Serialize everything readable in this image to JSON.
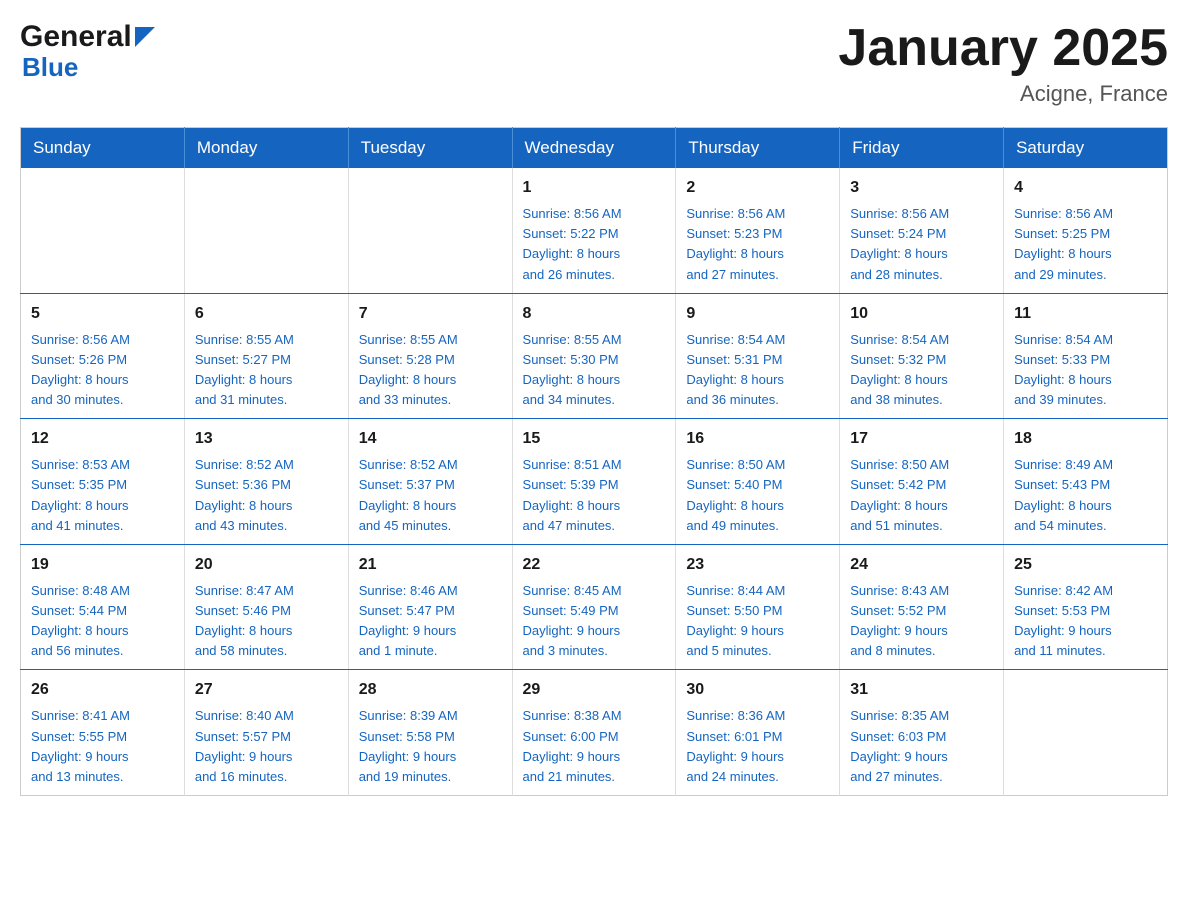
{
  "header": {
    "logo_general": "General",
    "logo_blue": "Blue",
    "title": "January 2025",
    "location": "Acigne, France"
  },
  "days_of_week": [
    "Sunday",
    "Monday",
    "Tuesday",
    "Wednesday",
    "Thursday",
    "Friday",
    "Saturday"
  ],
  "weeks": [
    [
      {
        "day": "",
        "info": []
      },
      {
        "day": "",
        "info": []
      },
      {
        "day": "",
        "info": []
      },
      {
        "day": "1",
        "info": [
          "Sunrise: 8:56 AM",
          "Sunset: 5:22 PM",
          "Daylight: 8 hours",
          "and 26 minutes."
        ]
      },
      {
        "day": "2",
        "info": [
          "Sunrise: 8:56 AM",
          "Sunset: 5:23 PM",
          "Daylight: 8 hours",
          "and 27 minutes."
        ]
      },
      {
        "day": "3",
        "info": [
          "Sunrise: 8:56 AM",
          "Sunset: 5:24 PM",
          "Daylight: 8 hours",
          "and 28 minutes."
        ]
      },
      {
        "day": "4",
        "info": [
          "Sunrise: 8:56 AM",
          "Sunset: 5:25 PM",
          "Daylight: 8 hours",
          "and 29 minutes."
        ]
      }
    ],
    [
      {
        "day": "5",
        "info": [
          "Sunrise: 8:56 AM",
          "Sunset: 5:26 PM",
          "Daylight: 8 hours",
          "and 30 minutes."
        ]
      },
      {
        "day": "6",
        "info": [
          "Sunrise: 8:55 AM",
          "Sunset: 5:27 PM",
          "Daylight: 8 hours",
          "and 31 minutes."
        ]
      },
      {
        "day": "7",
        "info": [
          "Sunrise: 8:55 AM",
          "Sunset: 5:28 PM",
          "Daylight: 8 hours",
          "and 33 minutes."
        ]
      },
      {
        "day": "8",
        "info": [
          "Sunrise: 8:55 AM",
          "Sunset: 5:30 PM",
          "Daylight: 8 hours",
          "and 34 minutes."
        ]
      },
      {
        "day": "9",
        "info": [
          "Sunrise: 8:54 AM",
          "Sunset: 5:31 PM",
          "Daylight: 8 hours",
          "and 36 minutes."
        ]
      },
      {
        "day": "10",
        "info": [
          "Sunrise: 8:54 AM",
          "Sunset: 5:32 PM",
          "Daylight: 8 hours",
          "and 38 minutes."
        ]
      },
      {
        "day": "11",
        "info": [
          "Sunrise: 8:54 AM",
          "Sunset: 5:33 PM",
          "Daylight: 8 hours",
          "and 39 minutes."
        ]
      }
    ],
    [
      {
        "day": "12",
        "info": [
          "Sunrise: 8:53 AM",
          "Sunset: 5:35 PM",
          "Daylight: 8 hours",
          "and 41 minutes."
        ]
      },
      {
        "day": "13",
        "info": [
          "Sunrise: 8:52 AM",
          "Sunset: 5:36 PM",
          "Daylight: 8 hours",
          "and 43 minutes."
        ]
      },
      {
        "day": "14",
        "info": [
          "Sunrise: 8:52 AM",
          "Sunset: 5:37 PM",
          "Daylight: 8 hours",
          "and 45 minutes."
        ]
      },
      {
        "day": "15",
        "info": [
          "Sunrise: 8:51 AM",
          "Sunset: 5:39 PM",
          "Daylight: 8 hours",
          "and 47 minutes."
        ]
      },
      {
        "day": "16",
        "info": [
          "Sunrise: 8:50 AM",
          "Sunset: 5:40 PM",
          "Daylight: 8 hours",
          "and 49 minutes."
        ]
      },
      {
        "day": "17",
        "info": [
          "Sunrise: 8:50 AM",
          "Sunset: 5:42 PM",
          "Daylight: 8 hours",
          "and 51 minutes."
        ]
      },
      {
        "day": "18",
        "info": [
          "Sunrise: 8:49 AM",
          "Sunset: 5:43 PM",
          "Daylight: 8 hours",
          "and 54 minutes."
        ]
      }
    ],
    [
      {
        "day": "19",
        "info": [
          "Sunrise: 8:48 AM",
          "Sunset: 5:44 PM",
          "Daylight: 8 hours",
          "and 56 minutes."
        ]
      },
      {
        "day": "20",
        "info": [
          "Sunrise: 8:47 AM",
          "Sunset: 5:46 PM",
          "Daylight: 8 hours",
          "and 58 minutes."
        ]
      },
      {
        "day": "21",
        "info": [
          "Sunrise: 8:46 AM",
          "Sunset: 5:47 PM",
          "Daylight: 9 hours",
          "and 1 minute."
        ]
      },
      {
        "day": "22",
        "info": [
          "Sunrise: 8:45 AM",
          "Sunset: 5:49 PM",
          "Daylight: 9 hours",
          "and 3 minutes."
        ]
      },
      {
        "day": "23",
        "info": [
          "Sunrise: 8:44 AM",
          "Sunset: 5:50 PM",
          "Daylight: 9 hours",
          "and 5 minutes."
        ]
      },
      {
        "day": "24",
        "info": [
          "Sunrise: 8:43 AM",
          "Sunset: 5:52 PM",
          "Daylight: 9 hours",
          "and 8 minutes."
        ]
      },
      {
        "day": "25",
        "info": [
          "Sunrise: 8:42 AM",
          "Sunset: 5:53 PM",
          "Daylight: 9 hours",
          "and 11 minutes."
        ]
      }
    ],
    [
      {
        "day": "26",
        "info": [
          "Sunrise: 8:41 AM",
          "Sunset: 5:55 PM",
          "Daylight: 9 hours",
          "and 13 minutes."
        ]
      },
      {
        "day": "27",
        "info": [
          "Sunrise: 8:40 AM",
          "Sunset: 5:57 PM",
          "Daylight: 9 hours",
          "and 16 minutes."
        ]
      },
      {
        "day": "28",
        "info": [
          "Sunrise: 8:39 AM",
          "Sunset: 5:58 PM",
          "Daylight: 9 hours",
          "and 19 minutes."
        ]
      },
      {
        "day": "29",
        "info": [
          "Sunrise: 8:38 AM",
          "Sunset: 6:00 PM",
          "Daylight: 9 hours",
          "and 21 minutes."
        ]
      },
      {
        "day": "30",
        "info": [
          "Sunrise: 8:36 AM",
          "Sunset: 6:01 PM",
          "Daylight: 9 hours",
          "and 24 minutes."
        ]
      },
      {
        "day": "31",
        "info": [
          "Sunrise: 8:35 AM",
          "Sunset: 6:03 PM",
          "Daylight: 9 hours",
          "and 27 minutes."
        ]
      },
      {
        "day": "",
        "info": []
      }
    ]
  ]
}
